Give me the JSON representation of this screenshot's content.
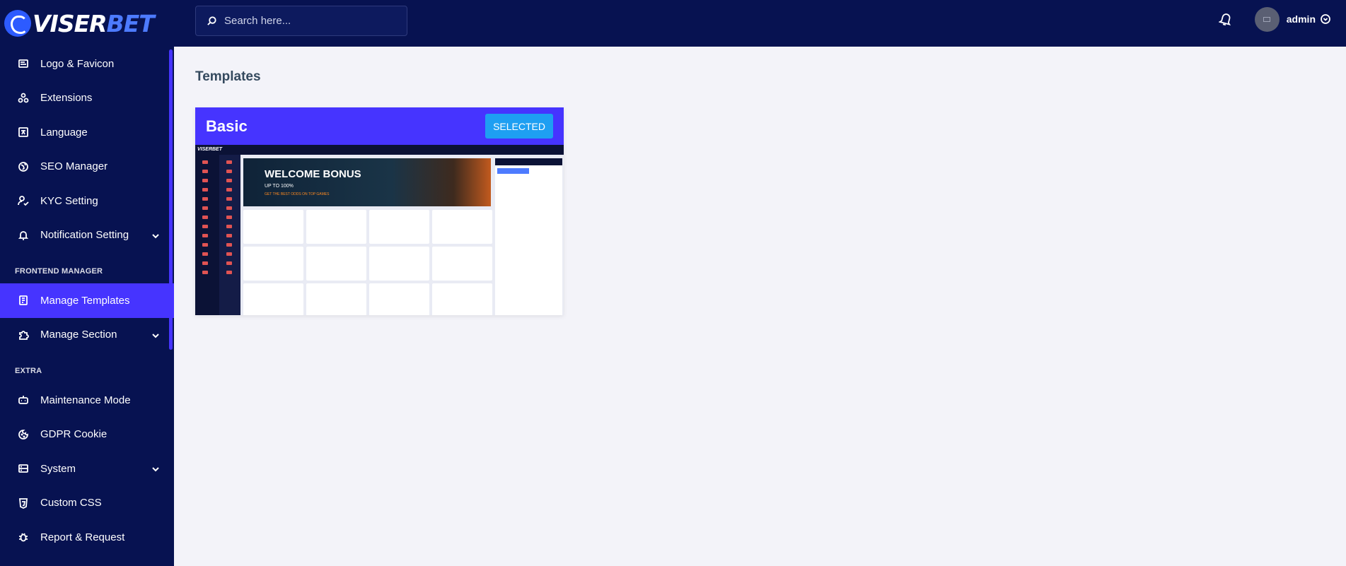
{
  "brand": {
    "name_part1": "VISER",
    "name_part2": "BET"
  },
  "sidebar": {
    "items": [
      {
        "label": "Logo & Favicon",
        "icon": "image-icon"
      },
      {
        "label": "Extensions",
        "icon": "puzzle-icon"
      },
      {
        "label": "Language",
        "icon": "language-icon"
      },
      {
        "label": "SEO Manager",
        "icon": "globe-icon"
      },
      {
        "label": "KYC Setting",
        "icon": "user-check-icon"
      },
      {
        "label": "Notification Setting",
        "icon": "bell-icon",
        "has_submenu": true
      }
    ],
    "section_frontend": "FRONTEND MANAGER",
    "frontend_items": [
      {
        "label": "Manage Templates",
        "icon": "template-icon",
        "active": true
      },
      {
        "label": "Manage Section",
        "icon": "puzzle-piece-icon",
        "has_submenu": true
      }
    ],
    "section_extra": "EXTRA",
    "extra_items": [
      {
        "label": "Maintenance Mode",
        "icon": "robot-icon"
      },
      {
        "label": "GDPR Cookie",
        "icon": "cookie-icon"
      },
      {
        "label": "System",
        "icon": "server-icon",
        "has_submenu": true
      },
      {
        "label": "Custom CSS",
        "icon": "css-icon"
      },
      {
        "label": "Report & Request",
        "icon": "bug-icon"
      }
    ]
  },
  "topbar": {
    "search_placeholder": "Search here...",
    "username": "admin"
  },
  "main": {
    "page_title": "Templates",
    "templates": [
      {
        "name": "Basic",
        "button_label": "SELECTED"
      }
    ],
    "preview": {
      "logo_text": "VISERBET",
      "banner_title": "WELCOME BONUS",
      "banner_subtitle": "UP TO 100%",
      "banner_tagline": "GET THE BEST ODDS ON TOP GAMES"
    }
  },
  "colors": {
    "sidebar_bg": "#071251",
    "accent": "#4634ff",
    "selected_button": "#1e9ff2",
    "page_bg": "#f3f3f9"
  }
}
